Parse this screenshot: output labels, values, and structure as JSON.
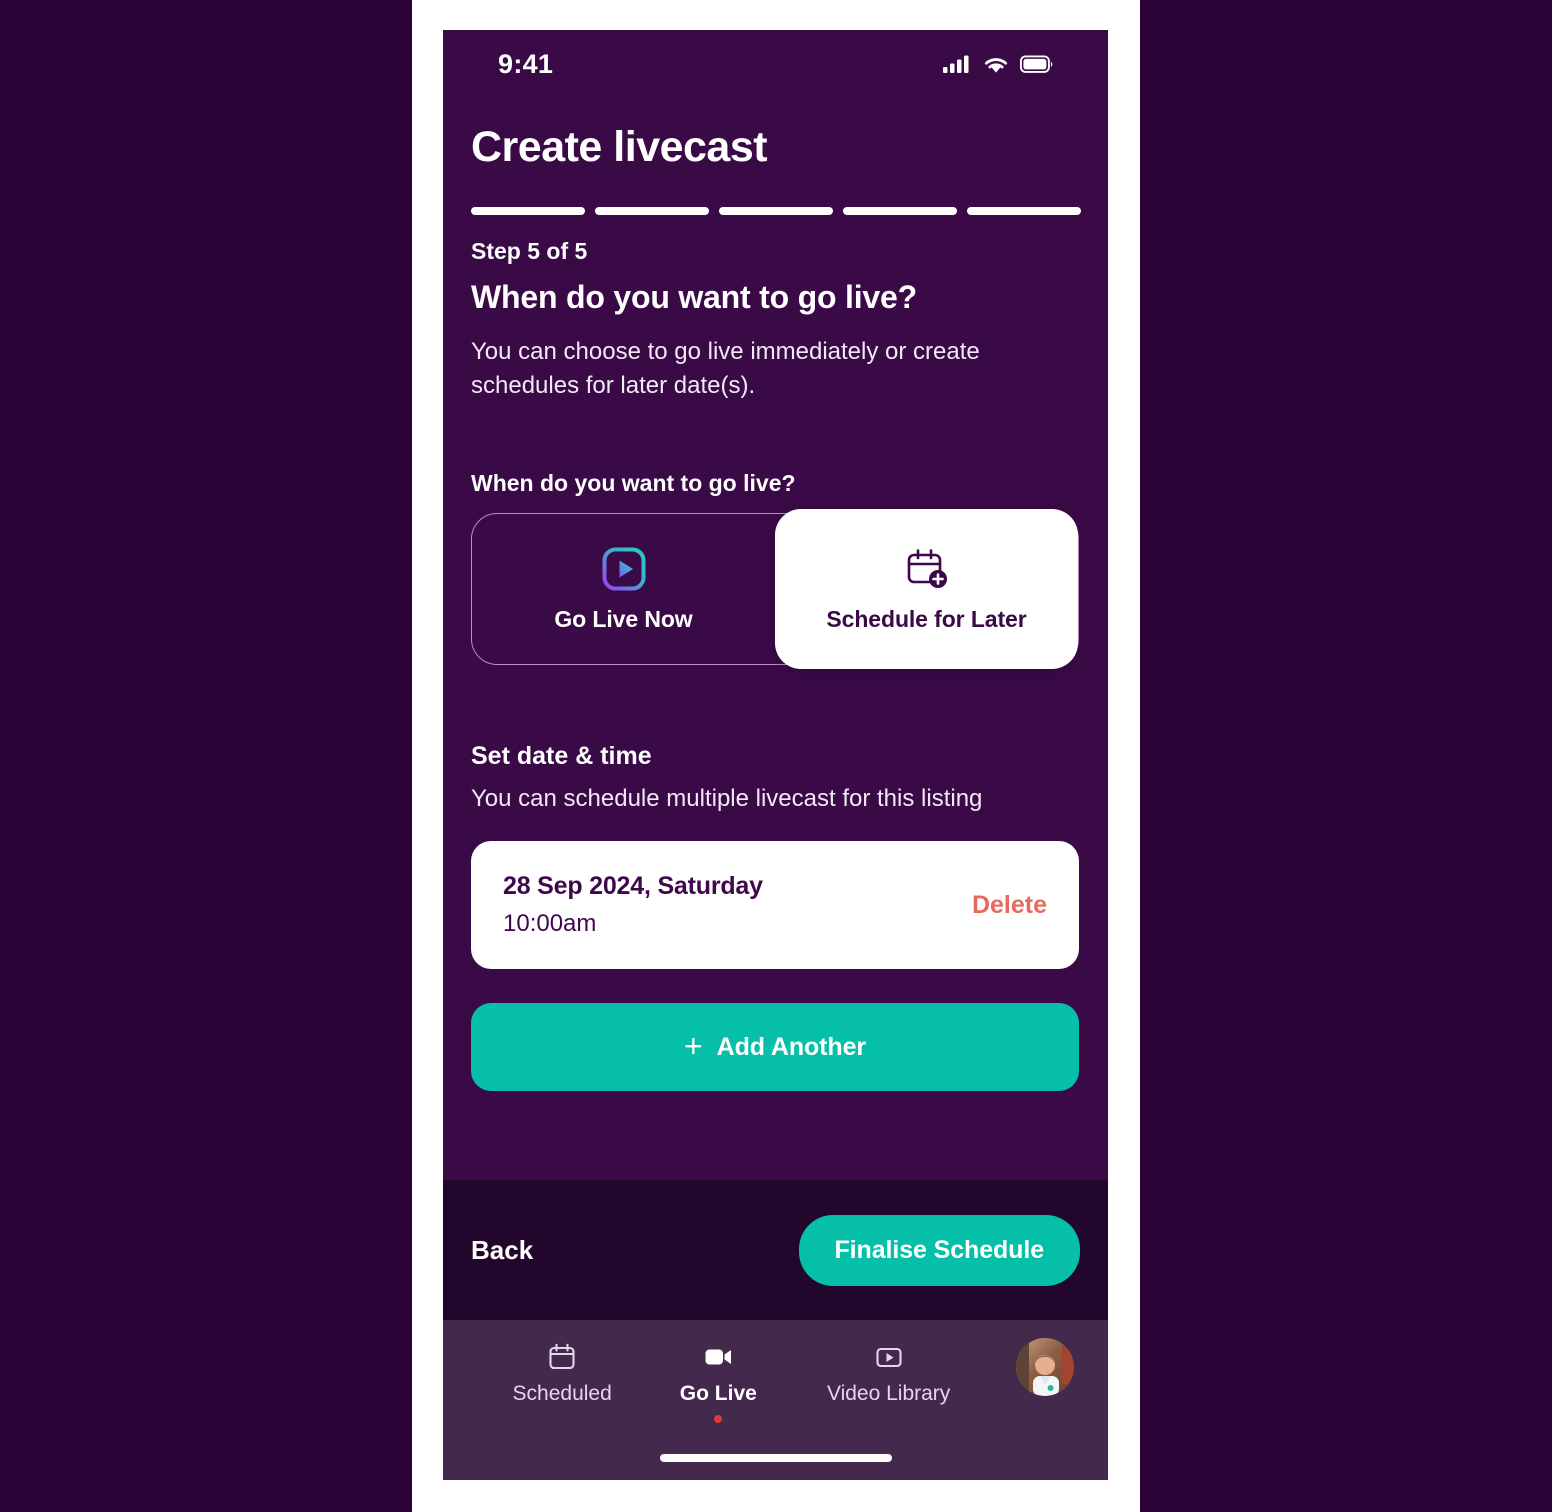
{
  "status_bar": {
    "time": "9:41",
    "signal_icon": "cellular-signal-icon",
    "wifi_icon": "wifi-icon",
    "battery_icon": "battery-full-icon"
  },
  "header": {
    "title": "Create livecast"
  },
  "progress": {
    "segments": [
      {
        "state": "done"
      },
      {
        "state": "done"
      },
      {
        "state": "done"
      },
      {
        "state": "done"
      },
      {
        "state": "done"
      }
    ]
  },
  "step": {
    "label": "Step 5 of 5",
    "heading": "When do you want to go live?",
    "description": "You can choose to go live immediately or create schedules for later date(s)."
  },
  "mode_section": {
    "question": "When do you want to go live?",
    "options": [
      {
        "label": "Go Live Now",
        "icon": "play-video-gradient-icon",
        "selected": false
      },
      {
        "label": "Schedule for Later",
        "icon": "calendar-plus-icon",
        "selected": true
      }
    ]
  },
  "datetime_section": {
    "title": "Set date & time",
    "subtitle": "You can schedule multiple livecast for this listing",
    "entries": [
      {
        "date": "28 Sep 2024, Saturday",
        "time": "10:00am",
        "delete_label": "Delete"
      }
    ],
    "add_button": {
      "label": "Add Another",
      "icon": "plus-icon"
    }
  },
  "action_bar": {
    "back_label": "Back",
    "primary_label": "Finalise Schedule"
  },
  "tab_bar": {
    "items": [
      {
        "label": "Scheduled",
        "icon": "calendar-icon",
        "active": false
      },
      {
        "label": "Go Live",
        "icon": "video-camera-icon",
        "active": true
      },
      {
        "label": "Video Library",
        "icon": "play-box-icon",
        "active": false
      }
    ],
    "avatar": "user-avatar"
  },
  "colors": {
    "background": "#3a0a47",
    "page_background": "#2b0339",
    "action_bar": "#22062b",
    "tab_bar": "#432a4d",
    "accent_teal": "#05bfa8",
    "delete_red": "#e8695f",
    "live_dot": "#e03a34",
    "deep_purple_text": "#40084c"
  }
}
